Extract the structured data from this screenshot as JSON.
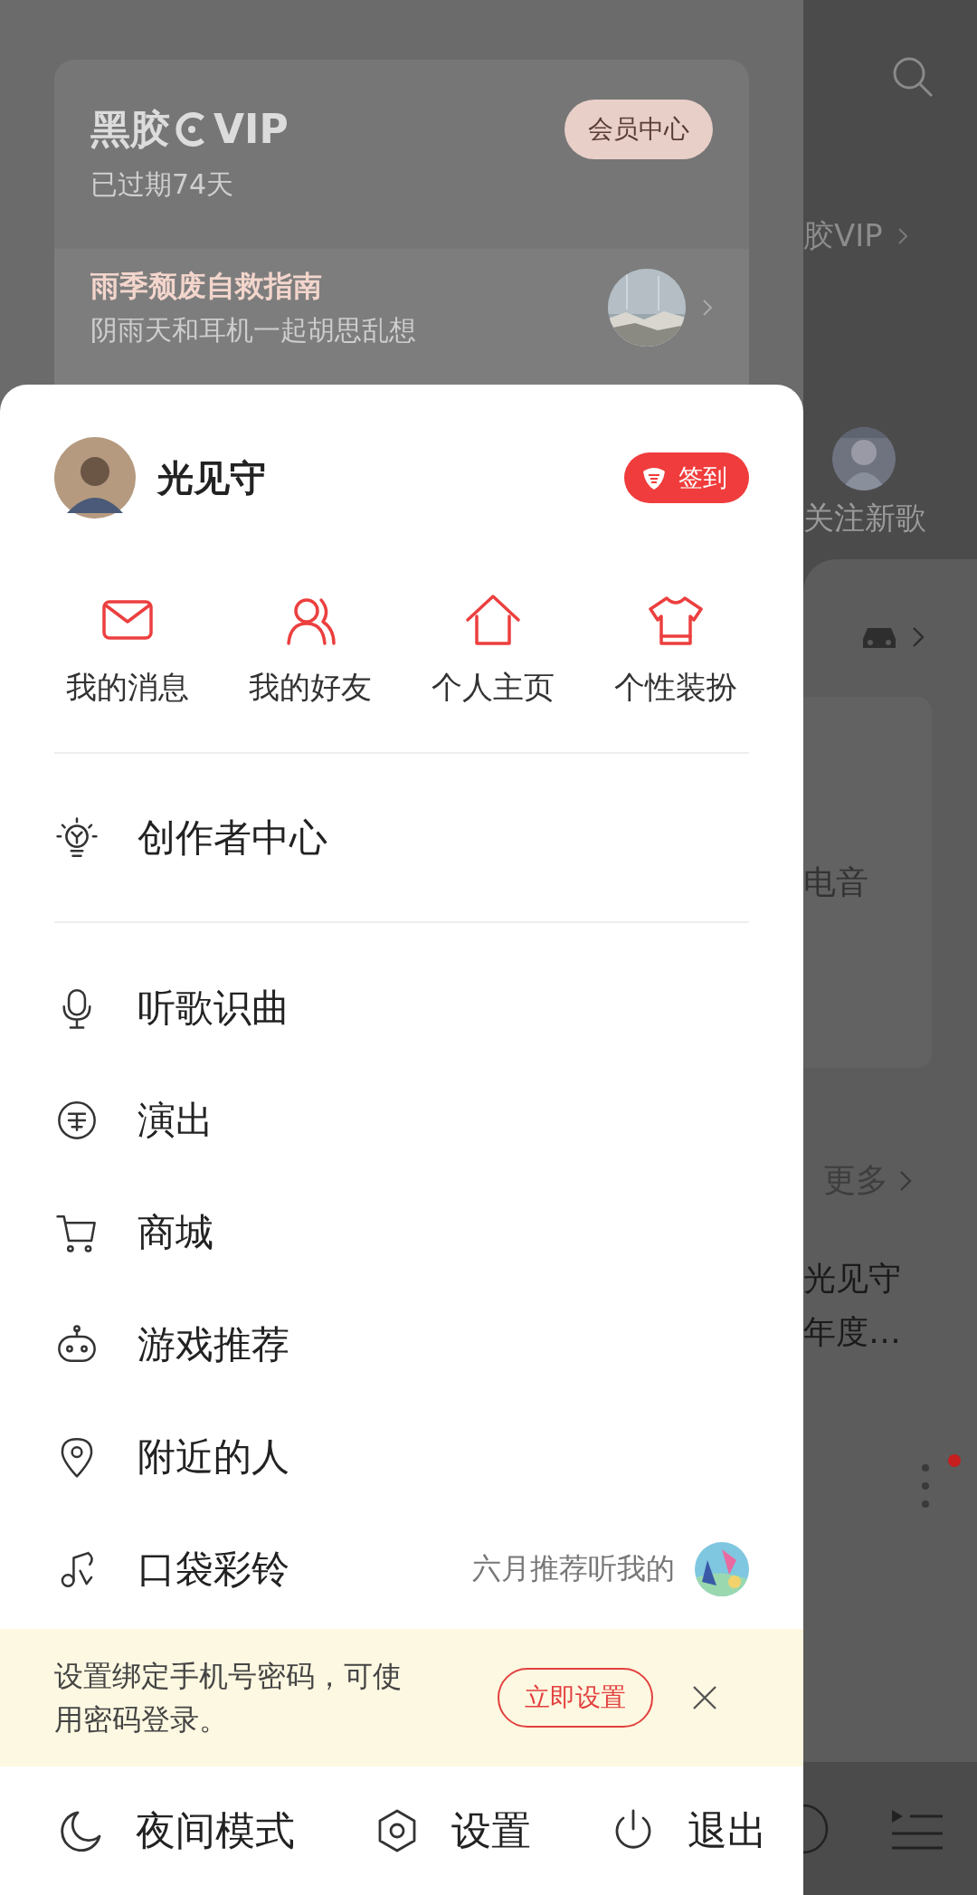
{
  "vip_card": {
    "logo_left": "黑胶",
    "logo_right": "VIP",
    "status": "已过期74天",
    "button": "会员中心",
    "promo_title": "雨季颓废自救指南",
    "promo_subtitle": "阴雨天和耳机一起胡思乱想"
  },
  "background_page": {
    "vip_link": "胶VIP",
    "follow_label": "关注新歌",
    "genre": "电音",
    "more": "更多",
    "song_title": "光见守",
    "song_subtitle": "年度…"
  },
  "drawer": {
    "user": {
      "name": "光见守",
      "checkin": "签到"
    },
    "shortcuts": [
      {
        "kind": "mail",
        "label": "我的消息"
      },
      {
        "kind": "friends",
        "label": "我的好友"
      },
      {
        "kind": "home",
        "label": "个人主页"
      },
      {
        "kind": "shirt",
        "label": "个性装扮"
      }
    ],
    "creator": {
      "kind": "bulb",
      "label": "创作者中心"
    },
    "menu": [
      {
        "kind": "mic",
        "label": "听歌识曲"
      },
      {
        "kind": "ticket",
        "label": "演出"
      },
      {
        "kind": "cart",
        "label": "商城"
      },
      {
        "kind": "game",
        "label": "游戏推荐"
      },
      {
        "kind": "pin",
        "label": "附近的人"
      },
      {
        "kind": "ring",
        "label": "口袋彩铃",
        "note": "六月推荐听我的"
      }
    ],
    "notice": {
      "text": "设置绑定手机号密码，可使用密码登录。",
      "button": "立即设置"
    },
    "footer": [
      {
        "kind": "moon",
        "label": "夜间模式"
      },
      {
        "kind": "gear",
        "label": "设置"
      },
      {
        "kind": "power",
        "label": "退出"
      }
    ]
  }
}
